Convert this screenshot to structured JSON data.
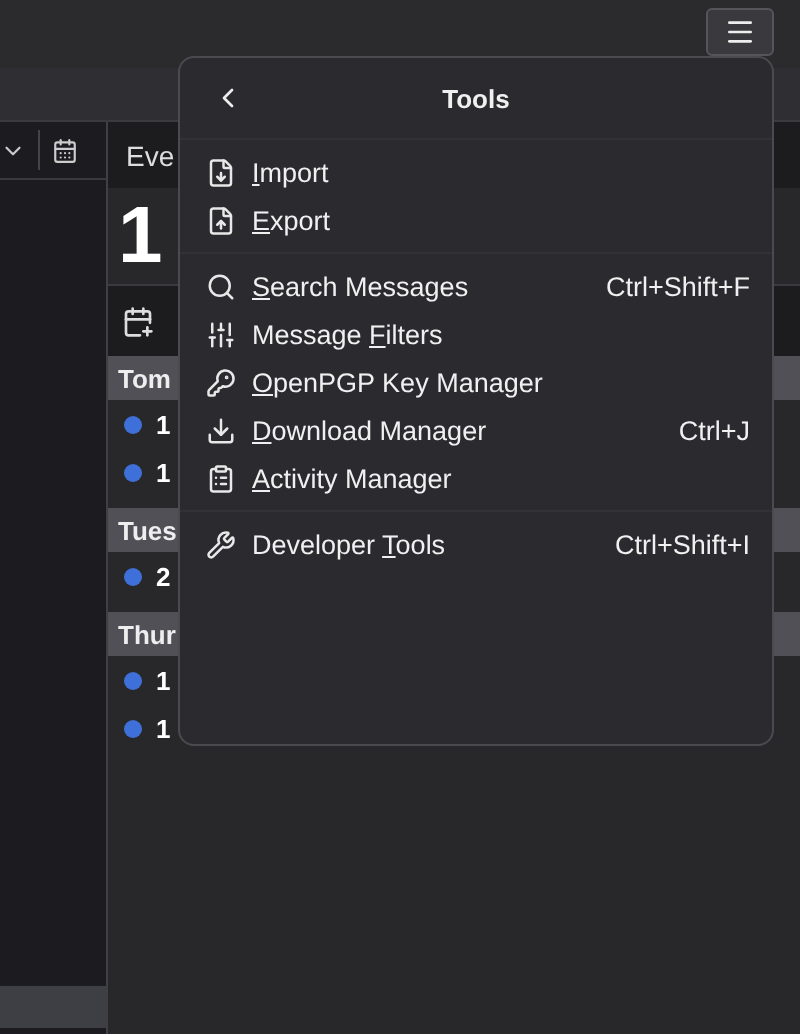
{
  "background": {
    "events_tab": "Eve",
    "date": "1",
    "groups": [
      {
        "label": "Tom",
        "events": [
          "1",
          "1"
        ]
      },
      {
        "label": "Tues",
        "events": [
          "2"
        ]
      },
      {
        "label": "Thur",
        "events": [
          "1",
          "1"
        ]
      }
    ]
  },
  "menu": {
    "title": "Tools",
    "sections": [
      [
        {
          "key": "I",
          "after": "mport"
        },
        {
          "key": "E",
          "after": "xport"
        }
      ],
      [
        {
          "key": "S",
          "after": "earch Messages",
          "shortcut": "Ctrl+Shift+F"
        },
        {
          "before": "Message ",
          "key": "F",
          "after": "ilters"
        },
        {
          "key": "O",
          "after": "penPGP Key Manager"
        },
        {
          "key": "D",
          "after": "ownload Manager",
          "shortcut": "Ctrl+J"
        },
        {
          "key": "A",
          "after": "ctivity Manager"
        }
      ],
      [
        {
          "before": "Developer ",
          "key": "T",
          "after": "ools",
          "shortcut": "Ctrl+Shift+I"
        }
      ]
    ]
  }
}
